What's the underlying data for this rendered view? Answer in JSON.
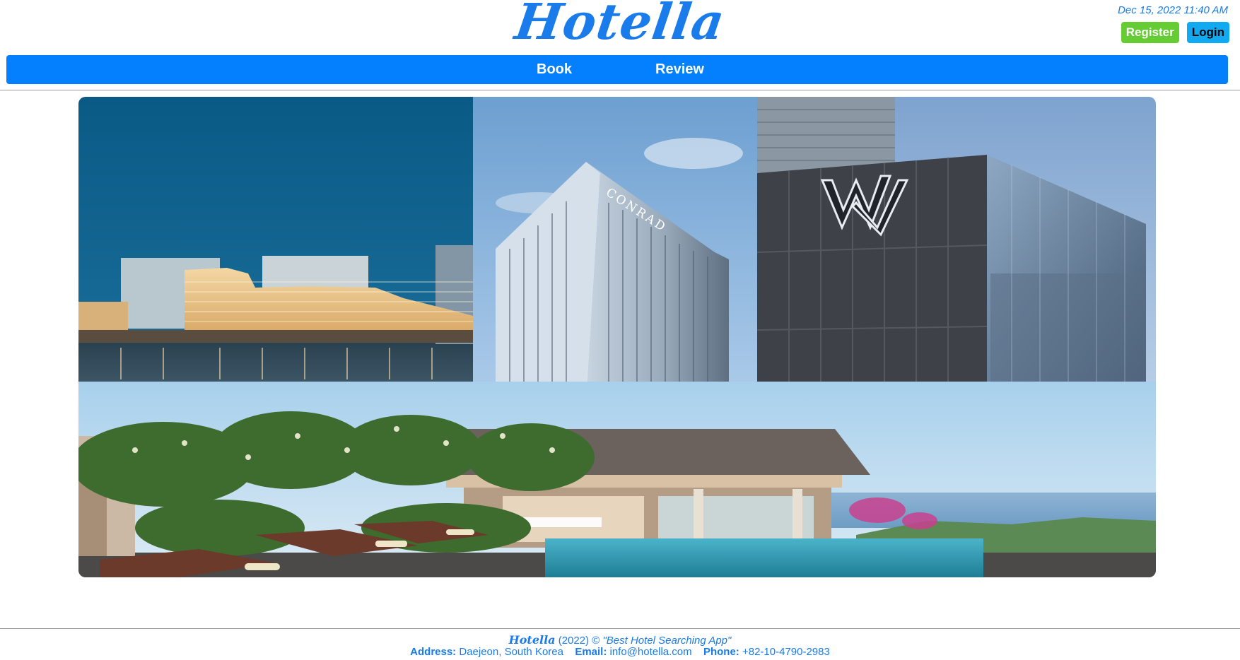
{
  "header": {
    "logo": "Hotella",
    "datetime": "Dec 15, 2022 11:40 AM",
    "register_label": "Register",
    "login_label": "Login"
  },
  "nav": {
    "items": [
      {
        "label": "Book"
      },
      {
        "label": "Review"
      }
    ]
  },
  "hero": {
    "images": [
      "riverside-hotel-photo",
      "conrad-tower-photo",
      "w-hotel-photo",
      "resort-pool-villa-photo"
    ],
    "signs": {
      "conrad": "CONRAD"
    }
  },
  "footer": {
    "logo": "Hotella",
    "year": "(2022) ©",
    "slogan": "\"Best Hotel Searching App\"",
    "address_label": "Address:",
    "address_value": "Daejeon, South Korea",
    "email_label": "Email:",
    "email_value": "info@hotella.com",
    "phone_label": "Phone:",
    "phone_value": "+82-10-4790-2983"
  },
  "colors": {
    "brand": "#1a7bea",
    "nav": "#0480fe",
    "register": "#66cc33",
    "login": "#11aaf0"
  }
}
